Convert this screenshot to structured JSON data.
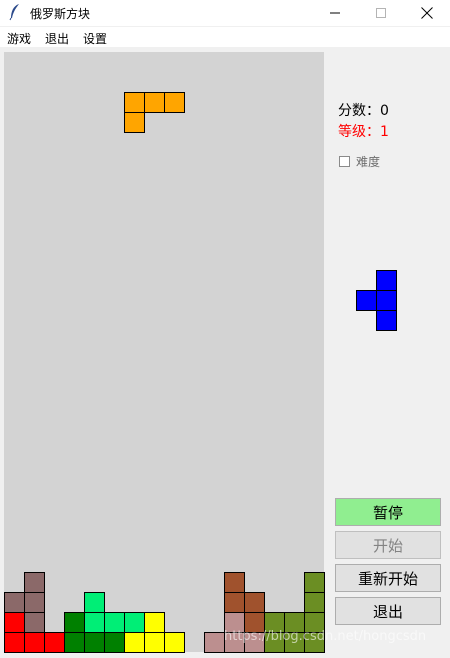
{
  "window": {
    "title": "俄罗斯方块"
  },
  "menu": {
    "items": [
      "游戏",
      "退出",
      "设置"
    ]
  },
  "board": {
    "cols": 16,
    "rows": 30,
    "background": "#d3d3d3",
    "falling_piece": {
      "color": "#ffa500",
      "cells": [
        [
          6,
          2
        ],
        [
          7,
          2
        ],
        [
          8,
          2
        ],
        [
          6,
          3
        ]
      ]
    },
    "stack": [
      {
        "c": 1,
        "r": 26,
        "color": "#8b6969"
      },
      {
        "c": 0,
        "r": 27,
        "color": "#8b6969"
      },
      {
        "c": 1,
        "r": 27,
        "color": "#8b6969"
      },
      {
        "c": 0,
        "r": 28,
        "color": "#ff0000"
      },
      {
        "c": 1,
        "r": 28,
        "color": "#8b6969"
      },
      {
        "c": 0,
        "r": 29,
        "color": "#ff0000"
      },
      {
        "c": 1,
        "r": 29,
        "color": "#ff0000"
      },
      {
        "c": 2,
        "r": 29,
        "color": "#ff0000"
      },
      {
        "c": 4,
        "r": 27,
        "color": "#00ee76"
      },
      {
        "c": 3,
        "r": 28,
        "color": "#008000"
      },
      {
        "c": 4,
        "r": 28,
        "color": "#00ee76"
      },
      {
        "c": 5,
        "r": 28,
        "color": "#00ee76"
      },
      {
        "c": 6,
        "r": 28,
        "color": "#00ee76"
      },
      {
        "c": 7,
        "r": 28,
        "color": "#ffff00"
      },
      {
        "c": 3,
        "r": 29,
        "color": "#008000"
      },
      {
        "c": 4,
        "r": 29,
        "color": "#008000"
      },
      {
        "c": 5,
        "r": 29,
        "color": "#008000"
      },
      {
        "c": 6,
        "r": 29,
        "color": "#ffff00"
      },
      {
        "c": 7,
        "r": 29,
        "color": "#ffff00"
      },
      {
        "c": 8,
        "r": 29,
        "color": "#ffff00"
      },
      {
        "c": 11,
        "r": 26,
        "color": "#a0522d"
      },
      {
        "c": 11,
        "r": 27,
        "color": "#a0522d"
      },
      {
        "c": 12,
        "r": 27,
        "color": "#a0522d"
      },
      {
        "c": 11,
        "r": 28,
        "color": "#bc8f8f"
      },
      {
        "c": 12,
        "r": 28,
        "color": "#a0522d"
      },
      {
        "c": 10,
        "r": 29,
        "color": "#bc8f8f"
      },
      {
        "c": 11,
        "r": 29,
        "color": "#bc8f8f"
      },
      {
        "c": 12,
        "r": 29,
        "color": "#bc8f8f"
      },
      {
        "c": 15,
        "r": 26,
        "color": "#6b8e23"
      },
      {
        "c": 15,
        "r": 27,
        "color": "#6b8e23"
      },
      {
        "c": 13,
        "r": 28,
        "color": "#6b8e23"
      },
      {
        "c": 14,
        "r": 28,
        "color": "#6b8e23"
      },
      {
        "c": 15,
        "r": 28,
        "color": "#6b8e23"
      },
      {
        "c": 13,
        "r": 29,
        "color": "#6b8e23"
      },
      {
        "c": 14,
        "r": 29,
        "color": "#6b8e23"
      },
      {
        "c": 15,
        "r": 29,
        "color": "#6b8e23"
      }
    ]
  },
  "score": {
    "label": "分数：",
    "value": "0",
    "color": "#000000"
  },
  "level": {
    "label": "等级：",
    "value": "1",
    "color": "#ff0000"
  },
  "difficulty": {
    "label": "难度",
    "checked": false
  },
  "next_piece": {
    "color": "#0000ff",
    "cells": [
      [
        1,
        0
      ],
      [
        0,
        1
      ],
      [
        1,
        1
      ],
      [
        1,
        2
      ]
    ]
  },
  "buttons": {
    "pause": {
      "label": "暂停",
      "color": "#90ee90"
    },
    "start": {
      "label": "开始",
      "disabled": true
    },
    "restart": {
      "label": "重新开始"
    },
    "exit": {
      "label": "退出"
    }
  },
  "watermark": "https://blog.csdn.net/hongcsdn"
}
